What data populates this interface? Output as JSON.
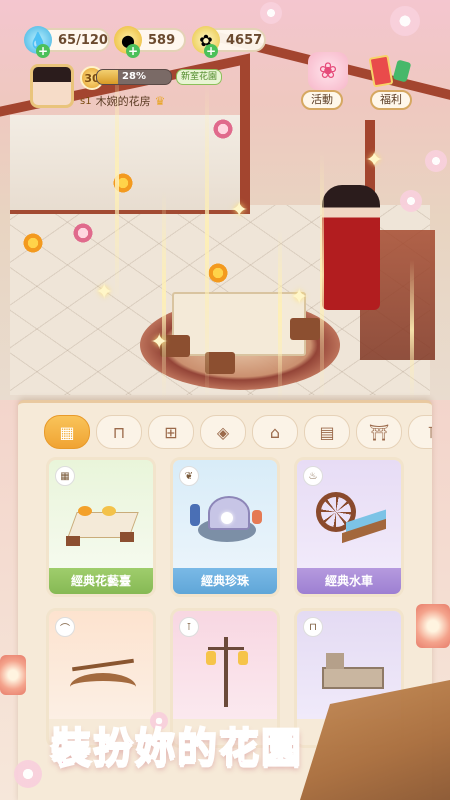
{
  "hud": {
    "stamina": "65/120",
    "coins": "589",
    "gems": "4657"
  },
  "player": {
    "level": "30",
    "xp_percent_text": "28%",
    "xp_fraction": 0.28,
    "new_tag": "新室花園",
    "garden_level": "s1",
    "garden_name": "木婉的花房"
  },
  "side_buttons": {
    "events": "活動",
    "welfare": "福利"
  },
  "tabs": [
    {
      "icon": "grid-icon",
      "glyph": "▦",
      "active": true
    },
    {
      "icon": "table-icon",
      "glyph": "⊓",
      "active": false
    },
    {
      "icon": "fence-icon",
      "glyph": "⊞",
      "active": false
    },
    {
      "icon": "tile-icon",
      "glyph": "◈",
      "active": false
    },
    {
      "icon": "pavilion-icon",
      "glyph": "⌂",
      "active": false
    },
    {
      "icon": "wall-icon",
      "glyph": "▤",
      "active": false
    },
    {
      "icon": "gate-icon",
      "glyph": "⛩",
      "active": false
    },
    {
      "icon": "lamp-icon",
      "glyph": "⊺",
      "active": false
    }
  ],
  "cards": [
    {
      "label": "經典花藝臺",
      "theme": "green"
    },
    {
      "label": "經典珍珠",
      "theme": "blue"
    },
    {
      "label": "經典水車",
      "theme": "purple"
    },
    {
      "label": "",
      "theme": "orange"
    },
    {
      "label": "",
      "theme": "pink"
    },
    {
      "label": "",
      "theme": "lav"
    }
  ],
  "banner": {
    "title": "裝扮妳的花園"
  },
  "colors": {
    "accent": "#e94b7a",
    "tab_active": "#f0a333"
  }
}
